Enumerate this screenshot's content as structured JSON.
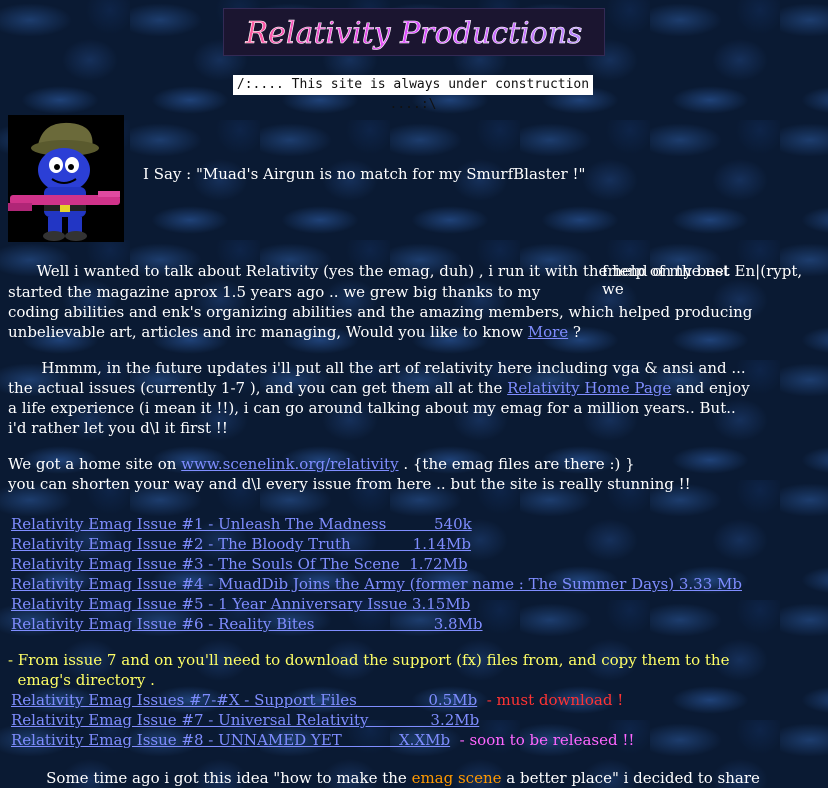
{
  "header": {
    "banner_text": "Relativity Productions",
    "construction": "/:.... This site is always under construction ....:\\"
  },
  "quote": "I Say  :  \"Muad's Airgun is no match for my SmurfBlaster !\"",
  "intro": {
    "p1a": "Well i wanted to talk about Relativity (yes the emag, duh) , i run it with the help of my best",
    "p1b": "friend on the net En|(rypt, we",
    "p1c": "started the magazine aprox 1.5 years ago .. we grew big thanks to my",
    "p1d": "coding abilities and enk's organizing abilities and the amazing members, which helped producing",
    "p1e": "unbelievable art, articles and irc managing, Would you like to know ",
    "more_link": "More",
    "p1f": " ?"
  },
  "future": {
    "p2a": "Hmmm, in the future updates i'll put all the art of relativity here including vga & ansi and ...",
    "p2b": "the actual issues (currently 1-7 ), and you can get them all at the ",
    "home_link": "Relativity Home Page",
    "p2c": " and enjoy",
    "p2d": "a life experience (i mean it !!), i can go around talking about my emag for a million years.. But..",
    "p2e": "i'd rather let you d\\l it first !!"
  },
  "homesite": {
    "p3a": "We got a home site on ",
    "site_link": "www.scenelink.org/relativity",
    "p3b": " . {the emag files are there :) }",
    "p3c": "you can shorten your way and d\\l every issue from here .. but the site is really stunning !!"
  },
  "issues": [
    "Relativity Emag Issue #1 - Unleash The Madness          540k",
    "Relativity Emag Issue #2 - The Bloody Truth             1.14Mb",
    "Relativity Emag Issue #3 - The Souls Of The Scene  1.72Mb",
    "Relativity Emag Issue #4 - MuadDib Joins the Army (former name : The Summer Days) 3.33 Mb",
    "Relativity Emag Issue #5 - 1 Year Anniversary Issue 3.15Mb",
    "Relativity Emag Issue #6 - Reality Bites                         3.8Mb"
  ],
  "support_note": {
    "line1": "- From issue 7 and on you'll need to download the support (fx) files from, and copy them to the",
    "line2": "  emag's directory ."
  },
  "issues2": [
    {
      "link": "Relativity Emag Issues #7-#X - Support Files               0.5Mb",
      "note": "  - must download !"
    },
    {
      "link": "Relativity Emag Issue #7 - Universal Relativity             3.2Mb",
      "note": ""
    },
    {
      "link": "Relativity Emag Issue #8 - UNNAMED YET            X.XMb",
      "note": "  - soon to be released !!"
    }
  ],
  "closing": {
    "c1": "Some time ago i got this idea \"how to make the ",
    "c_emag": "emag scene",
    "c2": " a better place\"  i decided to share"
  },
  "colors": {
    "link": "#7f8dff",
    "yellow": "#ffff66",
    "red": "#ff3333",
    "magenta": "#ff66ff",
    "orange": "#ff9900"
  }
}
